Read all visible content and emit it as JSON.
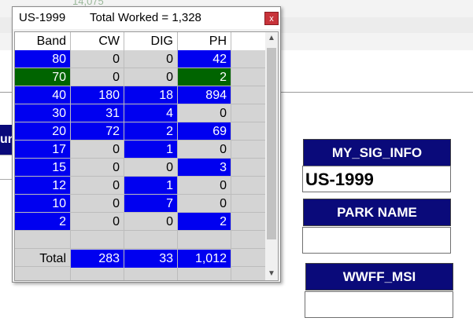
{
  "background": {
    "faded_text": "14,075",
    "left_tab_label": "ur"
  },
  "fields": {
    "my_sig_info": {
      "label": "MY_SIG_INFO",
      "value": "US-1999"
    },
    "park_name": {
      "label": "PARK NAME",
      "value": ""
    },
    "wwff_msi": {
      "label": "WWFF_MSI",
      "value": ""
    }
  },
  "window": {
    "callsign": "US-1999",
    "total_worked": "Total Worked = 1,328",
    "close_glyph": "x"
  },
  "table": {
    "headers": [
      "Band",
      "CW",
      "DIG",
      "PH"
    ],
    "rows": [
      {
        "band": "80",
        "cw": "0",
        "dig": "0",
        "ph": "42",
        "band_color": "blue",
        "cw_color": "",
        "dig_color": "",
        "ph_color": "blue"
      },
      {
        "band": "70",
        "cw": "0",
        "dig": "0",
        "ph": "2",
        "band_color": "green",
        "cw_color": "",
        "dig_color": "",
        "ph_color": "green"
      },
      {
        "band": "40",
        "cw": "180",
        "dig": "18",
        "ph": "894",
        "band_color": "blue",
        "cw_color": "blue",
        "dig_color": "blue",
        "ph_color": "blue"
      },
      {
        "band": "30",
        "cw": "31",
        "dig": "4",
        "ph": "0",
        "band_color": "blue",
        "cw_color": "blue",
        "dig_color": "blue",
        "ph_color": ""
      },
      {
        "band": "20",
        "cw": "72",
        "dig": "2",
        "ph": "69",
        "band_color": "blue",
        "cw_color": "blue",
        "dig_color": "blue",
        "ph_color": "blue"
      },
      {
        "band": "17",
        "cw": "0",
        "dig": "1",
        "ph": "0",
        "band_color": "blue",
        "cw_color": "",
        "dig_color": "blue",
        "ph_color": ""
      },
      {
        "band": "15",
        "cw": "0",
        "dig": "0",
        "ph": "3",
        "band_color": "blue",
        "cw_color": "",
        "dig_color": "",
        "ph_color": "blue"
      },
      {
        "band": "12",
        "cw": "0",
        "dig": "1",
        "ph": "0",
        "band_color": "blue",
        "cw_color": "",
        "dig_color": "blue",
        "ph_color": ""
      },
      {
        "band": "10",
        "cw": "0",
        "dig": "7",
        "ph": "0",
        "band_color": "blue",
        "cw_color": "",
        "dig_color": "blue",
        "ph_color": ""
      },
      {
        "band": "2",
        "cw": "0",
        "dig": "0",
        "ph": "2",
        "band_color": "blue",
        "cw_color": "",
        "dig_color": "",
        "ph_color": "blue"
      }
    ],
    "total": {
      "label": "Total",
      "cw": "283",
      "dig": "33",
      "ph": "1,012"
    }
  },
  "colors": {
    "blue": "#0000f0",
    "green": "#006400",
    "label_navy": "#0a0a7a",
    "close_red": "#c8333a"
  },
  "icons": {
    "close": "close-icon",
    "scroll_up": "chevron-up-icon",
    "scroll_down": "chevron-down-icon"
  }
}
